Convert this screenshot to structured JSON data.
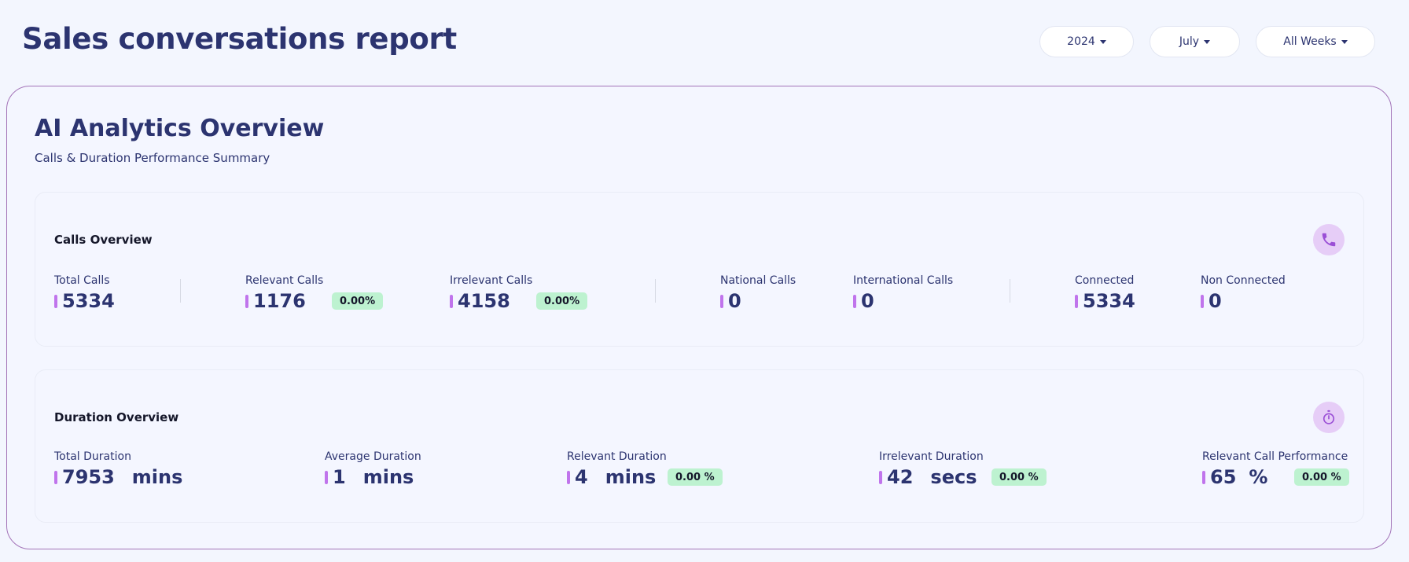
{
  "header": {
    "title": "Sales conversations report",
    "filters": {
      "year": "2024",
      "month": "July",
      "weeks": "All Weeks"
    }
  },
  "overview": {
    "title": "AI Analytics Overview",
    "subtitle": "Calls & Duration Performance Summary"
  },
  "calls": {
    "title": "Calls Overview",
    "icon": "phone-icon",
    "metrics": [
      {
        "label": "Total Calls",
        "value": "5334"
      },
      {
        "label": "Relevant Calls",
        "value": "1176",
        "badge": "0.00%"
      },
      {
        "label": "Irrelevant Calls",
        "value": "4158",
        "badge": "0.00%"
      },
      {
        "label": "National Calls",
        "value": "0"
      },
      {
        "label": "International Calls",
        "value": "0"
      },
      {
        "label": "Connected",
        "value": "5334"
      },
      {
        "label": "Non Connected",
        "value": "0"
      }
    ]
  },
  "duration": {
    "title": "Duration Overview",
    "icon": "stopwatch-icon",
    "metrics": [
      {
        "label": "Total Duration",
        "value": "7953",
        "unit": "mins"
      },
      {
        "label": "Average Duration",
        "value": "1",
        "unit": "mins"
      },
      {
        "label": "Relevant Duration",
        "value": "4",
        "unit": "mins",
        "badge": "0.00 %"
      },
      {
        "label": "Irrelevant Duration",
        "value": "42",
        "unit": "secs",
        "badge": "0.00 %"
      },
      {
        "label": "Relevant Call Performance",
        "value": "65",
        "unit": "%",
        "badge": "0.00 %"
      }
    ]
  },
  "colors": {
    "accent_bar": "#c074ec",
    "badge_bg": "#bdf2d0",
    "icon_bg": "#e6cdf7",
    "title_text": "#2c3470",
    "card_border": "#a374b8"
  }
}
